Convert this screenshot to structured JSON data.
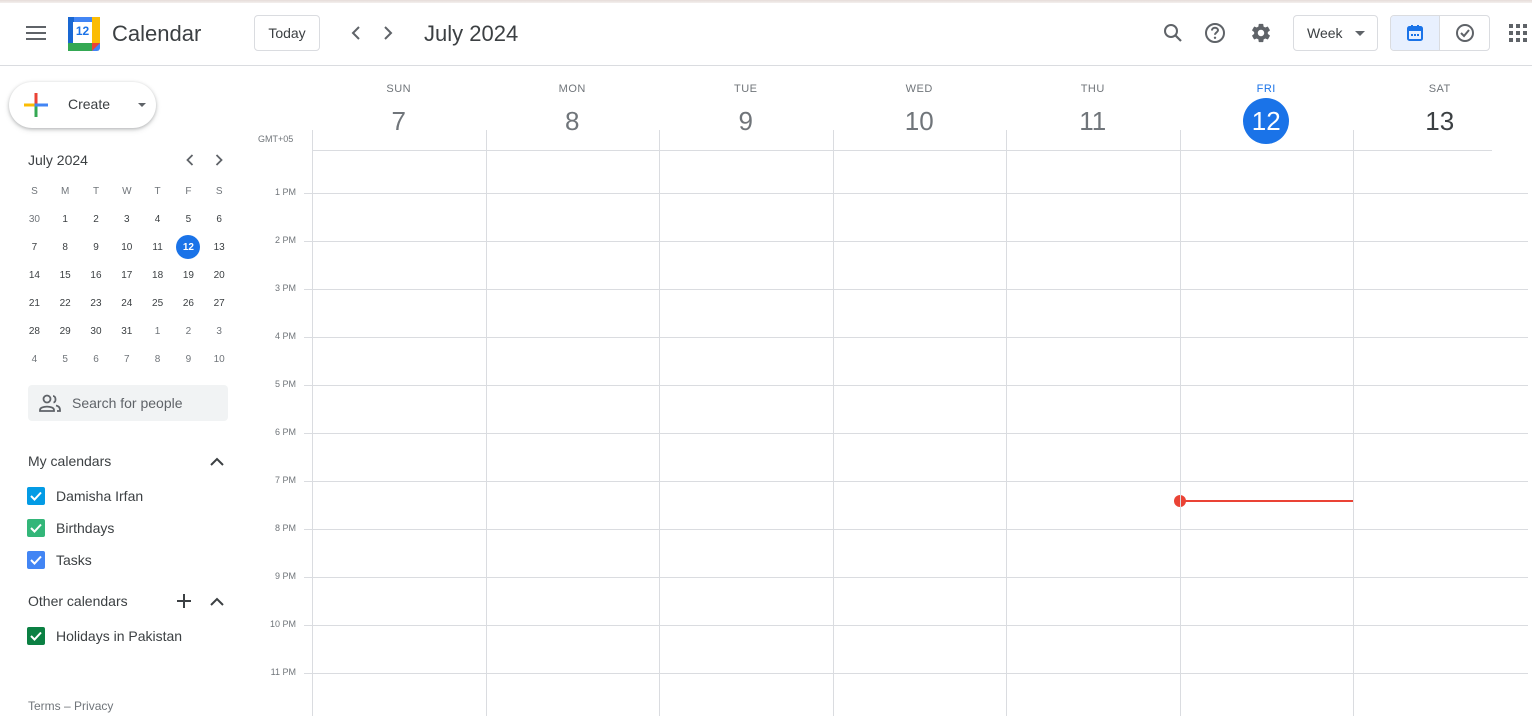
{
  "header": {
    "app_title": "Calendar",
    "logo_day": "12",
    "today_label": "Today",
    "date_range": "July 2024",
    "view_label": "Week"
  },
  "sidebar": {
    "create_label": "Create",
    "mini_calendar": {
      "title": "July 2024",
      "weekdays": [
        "S",
        "M",
        "T",
        "W",
        "T",
        "F",
        "S"
      ],
      "weeks": [
        [
          "30",
          "1",
          "2",
          "3",
          "4",
          "5",
          "6"
        ],
        [
          "7",
          "8",
          "9",
          "10",
          "11",
          "12",
          "13"
        ],
        [
          "14",
          "15",
          "16",
          "17",
          "18",
          "19",
          "20"
        ],
        [
          "21",
          "22",
          "23",
          "24",
          "25",
          "26",
          "27"
        ],
        [
          "28",
          "29",
          "30",
          "31",
          "1",
          "2",
          "3"
        ],
        [
          "4",
          "5",
          "6",
          "7",
          "8",
          "9",
          "10"
        ]
      ],
      "today": "12"
    },
    "people_search": {
      "placeholder": "Search for people"
    },
    "my_calendars": {
      "title": "My calendars",
      "items": [
        {
          "label": "Damisha Irfan",
          "color": "#039be5"
        },
        {
          "label": "Birthdays",
          "color": "#33b679"
        },
        {
          "label": "Tasks",
          "color": "#4285f4"
        }
      ]
    },
    "other_calendars": {
      "title": "Other calendars",
      "items": [
        {
          "label": "Holidays in Pakistan",
          "color": "#0b8043"
        }
      ]
    },
    "footer": {
      "terms": "Terms",
      "separator": "–",
      "privacy": "Privacy"
    }
  },
  "week": {
    "timezone": "GMT+05",
    "days": [
      {
        "name": "SUN",
        "num": "7"
      },
      {
        "name": "MON",
        "num": "8"
      },
      {
        "name": "TUE",
        "num": "9"
      },
      {
        "name": "WED",
        "num": "10"
      },
      {
        "name": "THU",
        "num": "11"
      },
      {
        "name": "FRI",
        "num": "12"
      },
      {
        "name": "SAT",
        "num": "13"
      }
    ],
    "hours": [
      "1 PM",
      "2 PM",
      "3 PM",
      "4 PM",
      "5 PM",
      "6 PM",
      "7 PM",
      "8 PM",
      "9 PM",
      "10 PM",
      "11 PM"
    ]
  },
  "colors": {
    "accent": "#1a73e8",
    "now_indicator": "#ea4335"
  }
}
